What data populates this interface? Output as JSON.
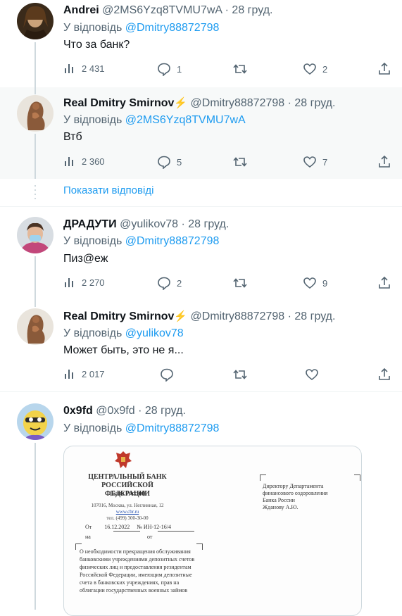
{
  "tweets": [
    {
      "name": "Andrei",
      "handle": "@2MS6Yzq8TVMU7wA · 28 груд.",
      "reply_prefix": "У відповідь",
      "reply_to": "@Dmitry88872798",
      "text": "Что за банк?",
      "views": "2 431",
      "replies": "1",
      "retweets": "",
      "likes": "2",
      "avatar_icon": "portrait-avatar"
    },
    {
      "name": "Real Dmitry Smirnov",
      "verified_icon": "lightning-icon",
      "handle": "@Dmitry88872798 · 28 груд.",
      "reply_prefix": "У відповідь",
      "reply_to": "@2MS6Yzq8TVMU7wA",
      "text": "Втб",
      "views": "2 360",
      "replies": "5",
      "retweets": "",
      "likes": "7",
      "avatar_icon": "sculpture-avatar"
    },
    {
      "name": "ДРАДУТИ",
      "handle": "@yulikov78 · 28 груд.",
      "reply_prefix": "У відповідь",
      "reply_to": "@Dmitry88872798",
      "text": "Пиз@еж",
      "views": "2 270",
      "replies": "2",
      "retweets": "",
      "likes": "9",
      "avatar_icon": "person-mask-avatar"
    },
    {
      "name": "Real Dmitry Smirnov",
      "verified_icon": "lightning-icon",
      "handle": "@Dmitry88872798 · 28 груд.",
      "reply_prefix": "У відповідь",
      "reply_to": "@yulikov78",
      "text": "Может быть, это не я...",
      "views": "2 017",
      "replies": "",
      "retweets": "",
      "likes": "",
      "avatar_icon": "sculpture-avatar"
    },
    {
      "name": "0x9fd",
      "handle": "@0x9fd · 28 груд.",
      "reply_prefix": "У відповідь",
      "reply_to": "@Dmitry88872798",
      "text": "",
      "avatar_icon": "cartoon-avatar"
    }
  ],
  "show_replies": "Показати відповіді",
  "document": {
    "bank_title_line1": "ЦЕНТРАЛЬНЫЙ БАНК",
    "bank_title_line2": "РОССИЙСКОЙ ФЕДЕРАЦИИ",
    "bank_sub": "(Банк России)",
    "address_line1": "107016, Москва, ул. Неглинная, 12",
    "address_line2": "www.cbr.ru",
    "address_line3": "тел. (499) 300-30-00",
    "date_label": "От",
    "date_value": "16.12.2022",
    "number_label": "№",
    "number_value": "ИН-12-16/4",
    "na_label": "на",
    "ot_label": "от",
    "recipient_line1": "Директору Департамента",
    "recipient_line2": "финансового оздоровления",
    "recipient_line3": "Банка России",
    "recipient_line4": "Жданову А.Ю.",
    "subject_line1": "О необходимости прекращения обслуживания",
    "subject_line2": "банковскими учреждениями депозитных счетов",
    "subject_line3": "физических лиц и предоставления резидентам",
    "subject_line4": "Российской Федерации, имеющим депозитные",
    "subject_line5": "счета в банковских учреждениях, прав на",
    "subject_line6": "облигации государственных военных займов"
  },
  "colors": {
    "accent": "#1d9bf0",
    "muted": "#536471",
    "highlight_bg": "#f7f9f9",
    "verified": "#f5b400"
  }
}
